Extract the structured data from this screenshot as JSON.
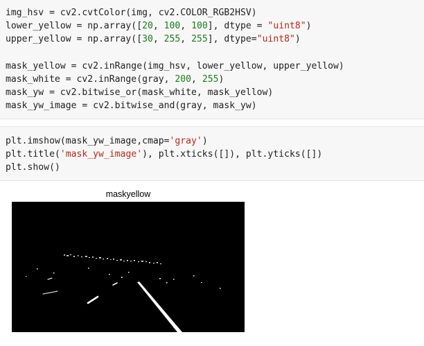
{
  "cell1": {
    "lines": [
      [
        {
          "t": "img_hsv = cv2.cvtColor(img, cv2.COLOR_RGB2HSV)",
          "c": ""
        }
      ],
      [
        {
          "t": "lower_yellow = np.array([",
          "c": ""
        },
        {
          "t": "20",
          "c": "num"
        },
        {
          "t": ", ",
          "c": ""
        },
        {
          "t": "100",
          "c": "num"
        },
        {
          "t": ", ",
          "c": ""
        },
        {
          "t": "100",
          "c": "num"
        },
        {
          "t": "], dtype = ",
          "c": ""
        },
        {
          "t": "\"uint8\"",
          "c": "str"
        },
        {
          "t": ")",
          "c": ""
        }
      ],
      [
        {
          "t": "upper_yellow = np.array([",
          "c": ""
        },
        {
          "t": "30",
          "c": "num"
        },
        {
          "t": ", ",
          "c": ""
        },
        {
          "t": "255",
          "c": "num"
        },
        {
          "t": ", ",
          "c": ""
        },
        {
          "t": "255",
          "c": "num"
        },
        {
          "t": "], dtype=",
          "c": ""
        },
        {
          "t": "\"uint8\"",
          "c": "str"
        },
        {
          "t": ")",
          "c": ""
        }
      ],
      [
        {
          "t": "",
          "c": ""
        }
      ],
      [
        {
          "t": "mask_yellow = cv2.inRange(img_hsv, lower_yellow, upper_yellow)",
          "c": ""
        }
      ],
      [
        {
          "t": "mask_white = cv2.inRange(gray, ",
          "c": ""
        },
        {
          "t": "200",
          "c": "num"
        },
        {
          "t": ", ",
          "c": ""
        },
        {
          "t": "255",
          "c": "num"
        },
        {
          "t": ")",
          "c": ""
        }
      ],
      [
        {
          "t": "mask_yw = cv2.bitwise_or(mask_white, mask_yellow)",
          "c": ""
        }
      ],
      [
        {
          "t": "mask_yw_image = cv2.bitwise_and(gray, mask_yw)",
          "c": ""
        }
      ]
    ]
  },
  "cell2": {
    "lines": [
      [
        {
          "t": "plt.imshow(mask_yw_image,cmap=",
          "c": ""
        },
        {
          "t": "'gray'",
          "c": "str"
        },
        {
          "t": ")",
          "c": ""
        }
      ],
      [
        {
          "t": "plt.title(",
          "c": ""
        },
        {
          "t": "'mask_yw_image'",
          "c": "str"
        },
        {
          "t": "), plt.xticks([]), plt.yticks([])",
          "c": ""
        }
      ],
      [
        {
          "t": "plt.show()",
          "c": ""
        }
      ]
    ]
  },
  "figure": {
    "title": "maskyellow",
    "background": "#000000",
    "foreground": "#ffffff"
  },
  "colors": {
    "cell_bg": "#f7f7f7",
    "number": "#1a7d1a",
    "string": "#b52a1d"
  }
}
